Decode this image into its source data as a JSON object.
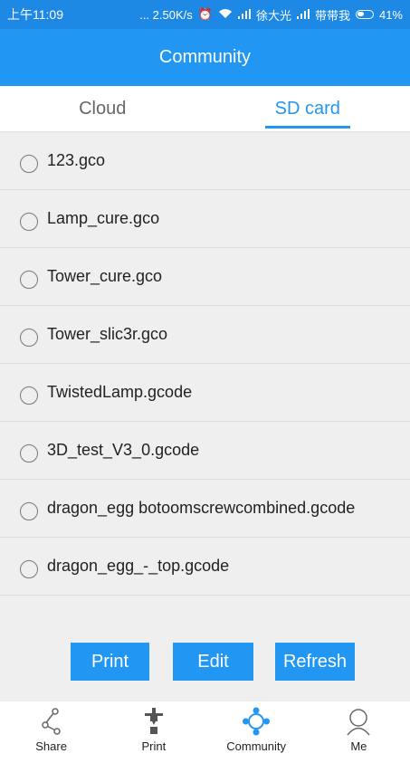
{
  "status_bar": {
    "time": "上午11:09",
    "network_speed": "... 2.50K/s",
    "carrier1": "徐大光",
    "carrier2": "带带我",
    "battery": "41%"
  },
  "app_bar": {
    "title": "Community"
  },
  "tabs": [
    {
      "label": "Cloud",
      "active": false
    },
    {
      "label": "SD card",
      "active": true
    }
  ],
  "files": [
    {
      "name": "123.gco"
    },
    {
      "name": "Lamp_cure.gco"
    },
    {
      "name": "Tower_cure.gco"
    },
    {
      "name": "Tower_slic3r.gco"
    },
    {
      "name": "TwistedLamp.gcode"
    },
    {
      "name": "3D_test_V3_0.gcode"
    },
    {
      "name": "dragon_egg botoomscrewcombined.gcode"
    },
    {
      "name": "dragon_egg_-_top.gcode"
    }
  ],
  "actions": {
    "print": "Print",
    "edit": "Edit",
    "refresh": "Refresh"
  },
  "bottom_nav": [
    {
      "label": "Share",
      "icon": "share-icon"
    },
    {
      "label": "Print",
      "icon": "printer-icon"
    },
    {
      "label": "Community",
      "icon": "community-icon",
      "active": true
    },
    {
      "label": "Me",
      "icon": "person-icon"
    }
  ],
  "colors": {
    "accent": "#2196f3",
    "status_bar": "#1e88e5"
  }
}
